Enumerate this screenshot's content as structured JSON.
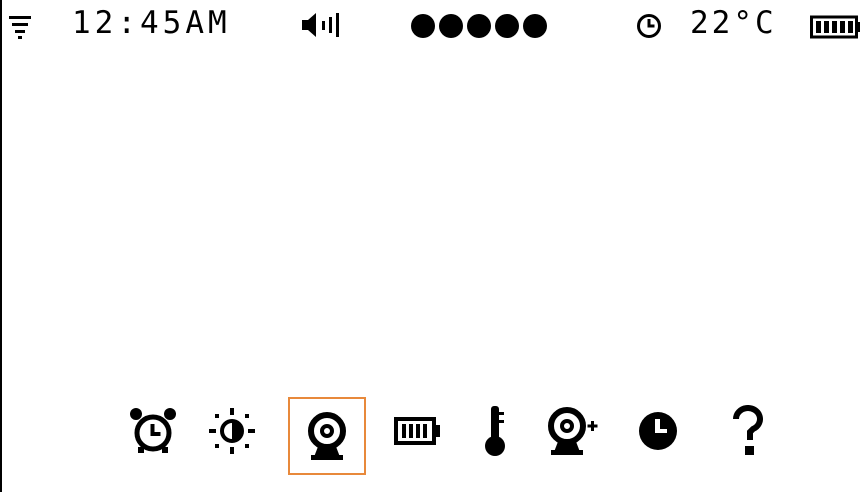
{
  "status_bar": {
    "time": "12:45AM",
    "temperature": "22°C",
    "icons": {
      "menu": "menu-icon",
      "volume": "speaker-volume-icon",
      "signal": "signal-dots-icon",
      "timer": "clock-icon",
      "battery": "battery-full-icon"
    },
    "signal_level": 5
  },
  "toolbar": {
    "selected_index": 2,
    "items": [
      {
        "icon": "alarm-clock-icon"
      },
      {
        "icon": "brightness-icon"
      },
      {
        "icon": "camera-icon"
      },
      {
        "icon": "battery-icon"
      },
      {
        "icon": "thermometer-icon"
      },
      {
        "icon": "add-camera-icon"
      },
      {
        "icon": "clock-icon"
      },
      {
        "icon": "help-icon"
      }
    ]
  },
  "colors": {
    "selection": "#e8893b",
    "foreground": "#000000",
    "background": "#ffffff"
  }
}
